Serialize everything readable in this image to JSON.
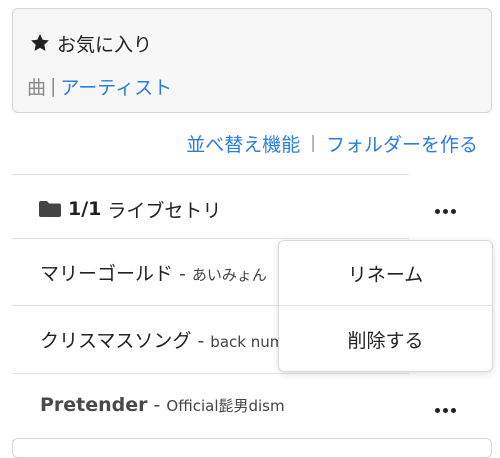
{
  "favorites": {
    "title": "お気に入り",
    "icon": "star-icon",
    "tab_song": "曲",
    "tab_separator": "|",
    "tab_artist": "アーティスト"
  },
  "actions": {
    "sort_label": "並べ替え機能",
    "separator": "|",
    "create_folder_label": "フォルダーを作る"
  },
  "folder": {
    "icon": "folder-icon",
    "count": "1/1",
    "name": "ライブセトリ"
  },
  "songs": [
    {
      "title": "マリーゴールド",
      "dash": "-",
      "artist": "あいみょん"
    },
    {
      "title": "クリスマスソング",
      "dash": "-",
      "artist": "back number"
    },
    {
      "title": "Pretender",
      "dash": "-",
      "artist": "Official髭男dism"
    }
  ],
  "menu": {
    "rename": "リネーム",
    "delete": "削除する"
  },
  "colors": {
    "link": "#2a7de1",
    "muted": "#8a8a8a",
    "card_bg": "#f7f7f7"
  }
}
